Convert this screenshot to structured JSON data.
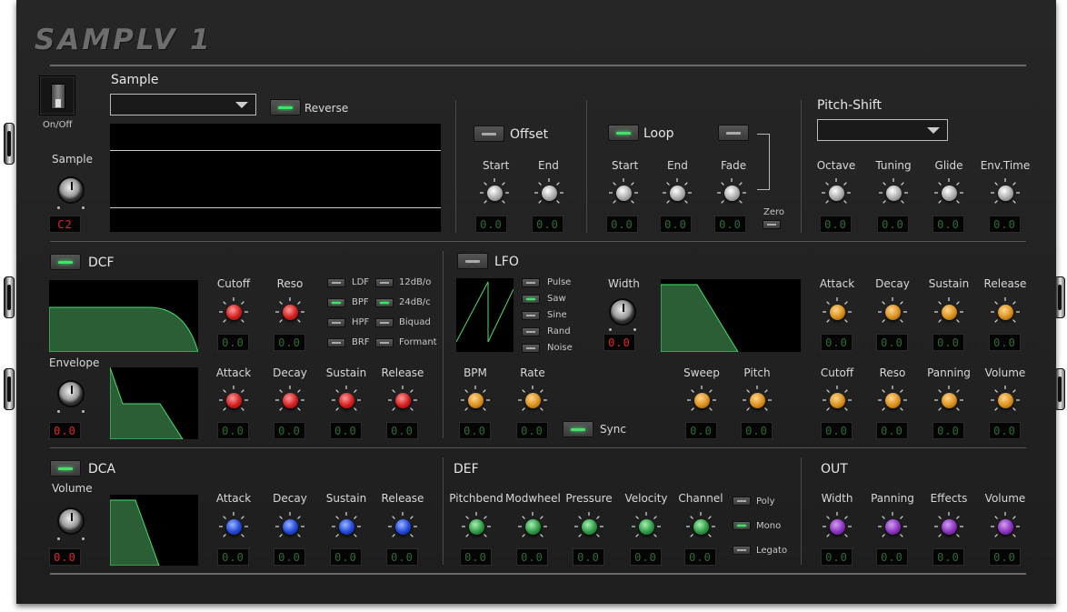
{
  "title": "SAMPLV 1",
  "sample": {
    "onoff_label": "On/Off",
    "section_label": "Sample",
    "knob_label": "Sample",
    "lcd": "C2",
    "reverse_label": "Reverse"
  },
  "offset": {
    "label": "Offset",
    "start_label": "Start",
    "end_label": "End",
    "start_value": "0.0",
    "end_value": "0.0"
  },
  "loop": {
    "label": "Loop",
    "start_label": "Start",
    "end_label": "End",
    "fade_label": "Fade",
    "zero_label": "Zero",
    "start_value": "0.0",
    "end_value": "0.0",
    "fade_value": "0.0"
  },
  "pitch": {
    "label": "Pitch-Shift",
    "knobs": [
      {
        "label": "Octave",
        "value": "0.0"
      },
      {
        "label": "Tuning",
        "value": "0.0"
      },
      {
        "label": "Glide",
        "value": "0.0"
      },
      {
        "label": "Env.Time",
        "value": "0.0"
      }
    ]
  },
  "dcf": {
    "label": "DCF",
    "envelope_label": "Envelope",
    "envelope_lcd": "0.0",
    "top_knobs": [
      {
        "label": "Cutoff",
        "value": "0.0"
      },
      {
        "label": "Reso",
        "value": "0.0"
      }
    ],
    "env_knobs": [
      {
        "label": "Attack",
        "value": "0.0"
      },
      {
        "label": "Decay",
        "value": "0.0"
      },
      {
        "label": "Sustain",
        "value": "0.0"
      },
      {
        "label": "Release",
        "value": "0.0"
      }
    ],
    "types": [
      "LDF",
      "BPF",
      "HPF",
      "BRF"
    ],
    "slopes": [
      "12dB/o",
      "24dB/c",
      "Biquad",
      "Formant"
    ]
  },
  "lfo": {
    "label": "LFO",
    "shapes": [
      "Pulse",
      "Saw",
      "Sine",
      "Rand",
      "Noise"
    ],
    "width_label": "Width",
    "width_lcd": "0.0",
    "sync_label": "Sync",
    "bottom_knobs": [
      {
        "label": "BPM",
        "value": "0.0"
      },
      {
        "label": "Rate",
        "value": "0.0"
      },
      {
        "label": "Sweep",
        "value": "0.0"
      },
      {
        "label": "Pitch",
        "value": "0.0"
      }
    ],
    "env_knobs": [
      {
        "label": "Attack",
        "value": "0.0"
      },
      {
        "label": "Decay",
        "value": "0.0"
      },
      {
        "label": "Sustain",
        "value": "0.0"
      },
      {
        "label": "Release",
        "value": "0.0"
      }
    ],
    "mod_knobs": [
      {
        "label": "Cutoff",
        "value": "0.0"
      },
      {
        "label": "Reso",
        "value": "0.0"
      },
      {
        "label": "Panning",
        "value": "0.0"
      },
      {
        "label": "Volume",
        "value": "0.0"
      }
    ]
  },
  "dca": {
    "label": "DCA",
    "volume_label": "Volume",
    "volume_lcd": "0.0",
    "env_knobs": [
      {
        "label": "Attack",
        "value": "0.0"
      },
      {
        "label": "Decay",
        "value": "0.0"
      },
      {
        "label": "Sustain",
        "value": "0.0"
      },
      {
        "label": "Release",
        "value": "0.0"
      }
    ]
  },
  "def": {
    "label": "DEF",
    "knobs": [
      {
        "label": "Pitchbend",
        "value": "0.0"
      },
      {
        "label": "Modwheel",
        "value": "0.0"
      },
      {
        "label": "Pressure",
        "value": "0.0"
      },
      {
        "label": "Velocity",
        "value": "0.0"
      },
      {
        "label": "Channel",
        "value": "0.0"
      }
    ],
    "modes": [
      "Poly",
      "Mono",
      "Legato"
    ]
  },
  "out": {
    "label": "OUT",
    "knobs": [
      {
        "label": "Width",
        "value": "0.0"
      },
      {
        "label": "Panning",
        "value": "0.0"
      },
      {
        "label": "Effects",
        "value": "0.0"
      },
      {
        "label": "Volume",
        "value": "0.0"
      }
    ]
  }
}
